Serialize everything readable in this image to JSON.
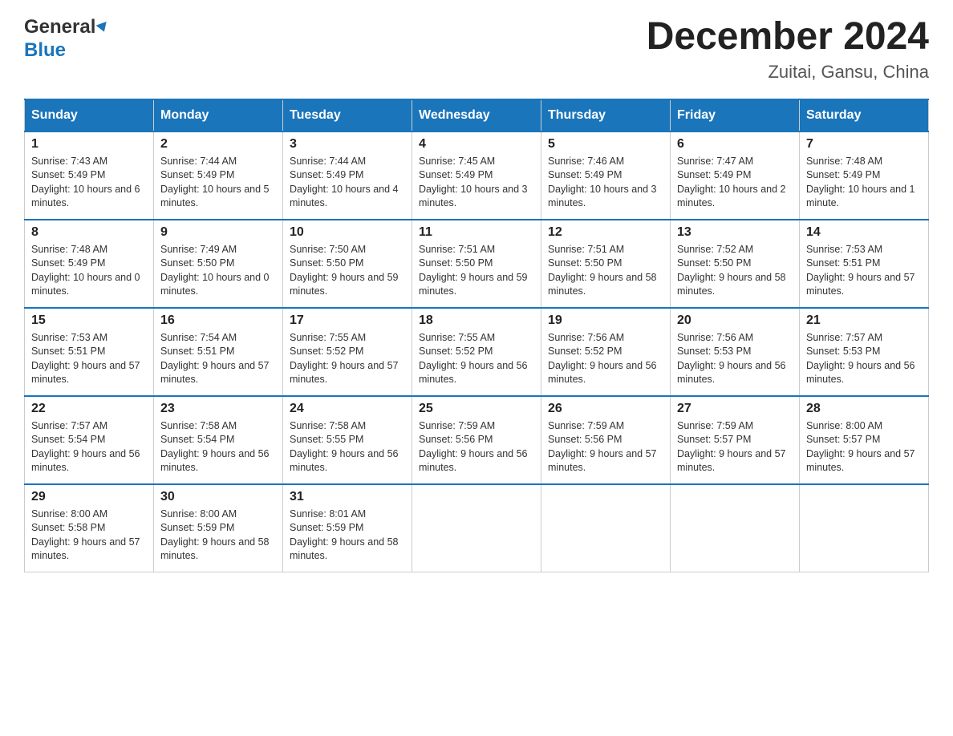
{
  "header": {
    "logo_general": "General",
    "logo_blue": "Blue",
    "title": "December 2024",
    "location": "Zuitai, Gansu, China"
  },
  "days_of_week": [
    "Sunday",
    "Monday",
    "Tuesday",
    "Wednesday",
    "Thursday",
    "Friday",
    "Saturday"
  ],
  "weeks": [
    [
      {
        "day": "1",
        "sunrise": "7:43 AM",
        "sunset": "5:49 PM",
        "daylight": "10 hours and 6 minutes."
      },
      {
        "day": "2",
        "sunrise": "7:44 AM",
        "sunset": "5:49 PM",
        "daylight": "10 hours and 5 minutes."
      },
      {
        "day": "3",
        "sunrise": "7:44 AM",
        "sunset": "5:49 PM",
        "daylight": "10 hours and 4 minutes."
      },
      {
        "day": "4",
        "sunrise": "7:45 AM",
        "sunset": "5:49 PM",
        "daylight": "10 hours and 3 minutes."
      },
      {
        "day": "5",
        "sunrise": "7:46 AM",
        "sunset": "5:49 PM",
        "daylight": "10 hours and 3 minutes."
      },
      {
        "day": "6",
        "sunrise": "7:47 AM",
        "sunset": "5:49 PM",
        "daylight": "10 hours and 2 minutes."
      },
      {
        "day": "7",
        "sunrise": "7:48 AM",
        "sunset": "5:49 PM",
        "daylight": "10 hours and 1 minute."
      }
    ],
    [
      {
        "day": "8",
        "sunrise": "7:48 AM",
        "sunset": "5:49 PM",
        "daylight": "10 hours and 0 minutes."
      },
      {
        "day": "9",
        "sunrise": "7:49 AM",
        "sunset": "5:50 PM",
        "daylight": "10 hours and 0 minutes."
      },
      {
        "day": "10",
        "sunrise": "7:50 AM",
        "sunset": "5:50 PM",
        "daylight": "9 hours and 59 minutes."
      },
      {
        "day": "11",
        "sunrise": "7:51 AM",
        "sunset": "5:50 PM",
        "daylight": "9 hours and 59 minutes."
      },
      {
        "day": "12",
        "sunrise": "7:51 AM",
        "sunset": "5:50 PM",
        "daylight": "9 hours and 58 minutes."
      },
      {
        "day": "13",
        "sunrise": "7:52 AM",
        "sunset": "5:50 PM",
        "daylight": "9 hours and 58 minutes."
      },
      {
        "day": "14",
        "sunrise": "7:53 AM",
        "sunset": "5:51 PM",
        "daylight": "9 hours and 57 minutes."
      }
    ],
    [
      {
        "day": "15",
        "sunrise": "7:53 AM",
        "sunset": "5:51 PM",
        "daylight": "9 hours and 57 minutes."
      },
      {
        "day": "16",
        "sunrise": "7:54 AM",
        "sunset": "5:51 PM",
        "daylight": "9 hours and 57 minutes."
      },
      {
        "day": "17",
        "sunrise": "7:55 AM",
        "sunset": "5:52 PM",
        "daylight": "9 hours and 57 minutes."
      },
      {
        "day": "18",
        "sunrise": "7:55 AM",
        "sunset": "5:52 PM",
        "daylight": "9 hours and 56 minutes."
      },
      {
        "day": "19",
        "sunrise": "7:56 AM",
        "sunset": "5:52 PM",
        "daylight": "9 hours and 56 minutes."
      },
      {
        "day": "20",
        "sunrise": "7:56 AM",
        "sunset": "5:53 PM",
        "daylight": "9 hours and 56 minutes."
      },
      {
        "day": "21",
        "sunrise": "7:57 AM",
        "sunset": "5:53 PM",
        "daylight": "9 hours and 56 minutes."
      }
    ],
    [
      {
        "day": "22",
        "sunrise": "7:57 AM",
        "sunset": "5:54 PM",
        "daylight": "9 hours and 56 minutes."
      },
      {
        "day": "23",
        "sunrise": "7:58 AM",
        "sunset": "5:54 PM",
        "daylight": "9 hours and 56 minutes."
      },
      {
        "day": "24",
        "sunrise": "7:58 AM",
        "sunset": "5:55 PM",
        "daylight": "9 hours and 56 minutes."
      },
      {
        "day": "25",
        "sunrise": "7:59 AM",
        "sunset": "5:56 PM",
        "daylight": "9 hours and 56 minutes."
      },
      {
        "day": "26",
        "sunrise": "7:59 AM",
        "sunset": "5:56 PM",
        "daylight": "9 hours and 57 minutes."
      },
      {
        "day": "27",
        "sunrise": "7:59 AM",
        "sunset": "5:57 PM",
        "daylight": "9 hours and 57 minutes."
      },
      {
        "day": "28",
        "sunrise": "8:00 AM",
        "sunset": "5:57 PM",
        "daylight": "9 hours and 57 minutes."
      }
    ],
    [
      {
        "day": "29",
        "sunrise": "8:00 AM",
        "sunset": "5:58 PM",
        "daylight": "9 hours and 57 minutes."
      },
      {
        "day": "30",
        "sunrise": "8:00 AM",
        "sunset": "5:59 PM",
        "daylight": "9 hours and 58 minutes."
      },
      {
        "day": "31",
        "sunrise": "8:01 AM",
        "sunset": "5:59 PM",
        "daylight": "9 hours and 58 minutes."
      },
      null,
      null,
      null,
      null
    ]
  ],
  "labels": {
    "sunrise": "Sunrise: ",
    "sunset": "Sunset: ",
    "daylight": "Daylight: "
  }
}
